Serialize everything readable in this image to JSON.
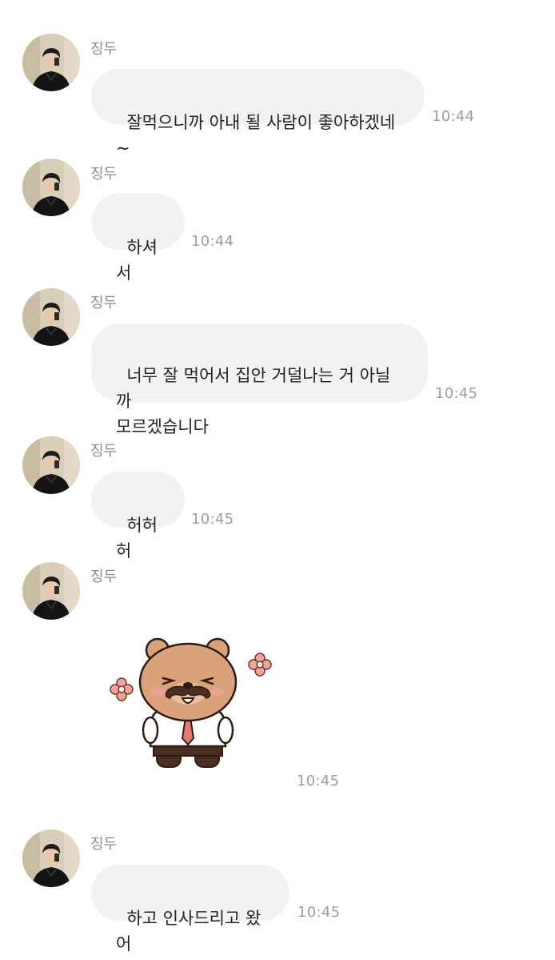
{
  "messages": [
    {
      "sender": "징두",
      "text": "잘먹으니까 아내 될 사람이 좋아하겠네~",
      "time": "10:44",
      "avatar": "profile-photo"
    },
    {
      "sender": "징두",
      "text": "하셔서",
      "time": "10:44",
      "avatar": "profile-photo"
    },
    {
      "sender": "징두",
      "text": "너무 잘 먹어서 집안 거덜나는 거 아닐까\n모르겠습니다",
      "time": "10:45",
      "avatar": "profile-photo"
    },
    {
      "sender": "징두",
      "text": "허허허",
      "time": "10:45",
      "avatar": "profile-photo"
    },
    {
      "sender": "징두",
      "sticker": "bear-with-mustache-and-tie-sticker",
      "time": "10:45",
      "avatar": "profile-photo"
    },
    {
      "sender": "징두",
      "text": "하고 인사드리고 왔어",
      "time": "10:45",
      "avatar": "profile-photo"
    }
  ],
  "colors": {
    "bubble": "#f2f2f4",
    "text": "#222222",
    "meta": "#9d9da2"
  }
}
